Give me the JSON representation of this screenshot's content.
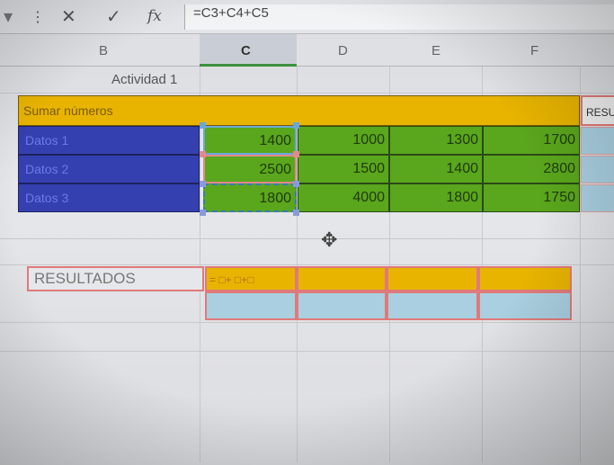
{
  "formula_bar": {
    "formula": "=C3+C4+C5",
    "icons": [
      "cancel-icon",
      "enter-icon",
      "function-icon"
    ]
  },
  "columns": [
    "B",
    "C",
    "D",
    "E",
    "F"
  ],
  "sheet": {
    "title": "Actividad 1",
    "header": "Sumar números",
    "result_header": "RESU",
    "rows": [
      {
        "label": "Datos 1",
        "values": [
          "1400",
          "1000",
          "1300",
          "1700"
        ]
      },
      {
        "label": "Datos 2",
        "values": [
          "2500",
          "1500",
          "1400",
          "2800"
        ]
      },
      {
        "label": "Datos 3",
        "values": [
          "1800",
          "4000",
          "1800",
          "1750"
        ]
      }
    ],
    "results_label": "RESULTADOS",
    "results_formula": "= □+ □+□"
  },
  "colors": {
    "yellow": "#e8b400",
    "blue": "#3540b0",
    "green": "#5aa61c",
    "light_blue": "#a9cfe0",
    "pink": "#e07a7a"
  }
}
